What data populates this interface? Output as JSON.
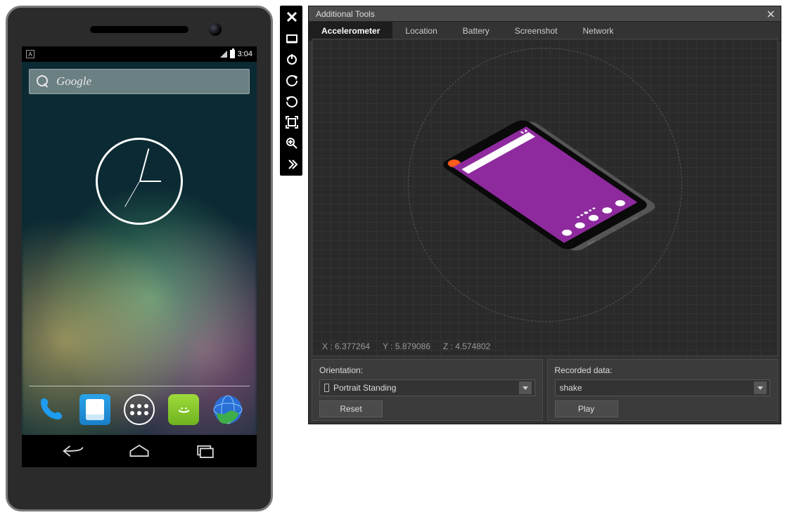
{
  "phone": {
    "status_time": "3:04",
    "search_placeholder": "Google"
  },
  "emulator_toolbar": {
    "items": [
      {
        "name": "close-icon"
      },
      {
        "name": "minimize-icon"
      },
      {
        "name": "power-icon"
      },
      {
        "name": "rotate-left-icon"
      },
      {
        "name": "rotate-right-icon"
      },
      {
        "name": "fit-screen-icon"
      },
      {
        "name": "zoom-icon"
      },
      {
        "name": "more-icon"
      }
    ]
  },
  "tools": {
    "title": "Additional Tools",
    "tabs": [
      "Accelerometer",
      "Location",
      "Battery",
      "Screenshot",
      "Network"
    ],
    "active_tab": "Accelerometer",
    "coords": {
      "x_label": "X : 6.377264",
      "y_label": "Y : 5.879086",
      "z_label": "Z : 4.574802"
    },
    "orientation": {
      "label": "Orientation:",
      "value": "Portrait Standing",
      "button": "Reset"
    },
    "recorded": {
      "label": "Recorded data:",
      "value": "shake",
      "button": "Play"
    }
  }
}
